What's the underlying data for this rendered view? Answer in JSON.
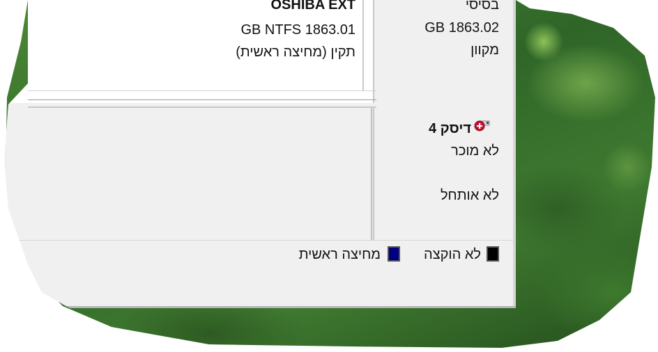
{
  "volume": {
    "name": "OSHIBA EXT",
    "size_fs": "GB NTFS 1863.01",
    "status": "תקין (מחיצה ראשית)"
  },
  "disk3": {
    "type": "בסיסי",
    "size": "GB 1863.02",
    "state": "מקוון"
  },
  "disk4": {
    "title": "דיסק 4",
    "state": "לא מוכר",
    "init": "לא אותחל"
  },
  "legend": {
    "unallocated": "לא הוקצה",
    "primary": "מחיצה ראשית",
    "unallocated_color": "#000000",
    "primary_color": "#000080"
  },
  "icons": {
    "disk": "disk-error-icon"
  }
}
